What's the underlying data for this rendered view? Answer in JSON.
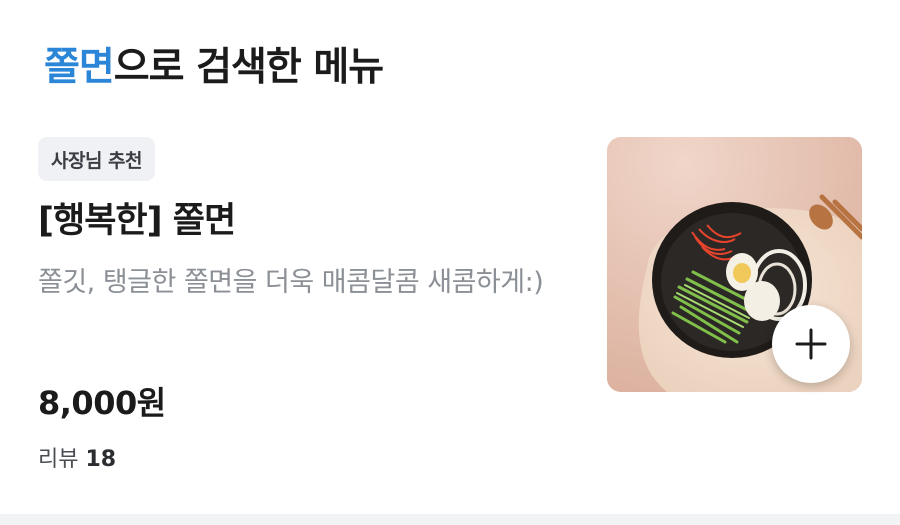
{
  "header": {
    "keyword": "쫄면",
    "suffix": "으로 검색한 메뉴"
  },
  "menu_item": {
    "badge": "사장님 추천",
    "name": "[행복한] 쫄면",
    "description": "쫄깃, 탱글한 쫄면을 더욱 매콤달콤 새콤하게:)",
    "price": "8,000원",
    "review_label": "리뷰",
    "review_count": "18",
    "image_icon": "noodle-bowl-photo",
    "add_icon": "plus-icon"
  },
  "colors": {
    "keyword_accent": "#2c86d8",
    "badge_bg": "#f0f1f4",
    "description_text": "#8b8f96"
  }
}
